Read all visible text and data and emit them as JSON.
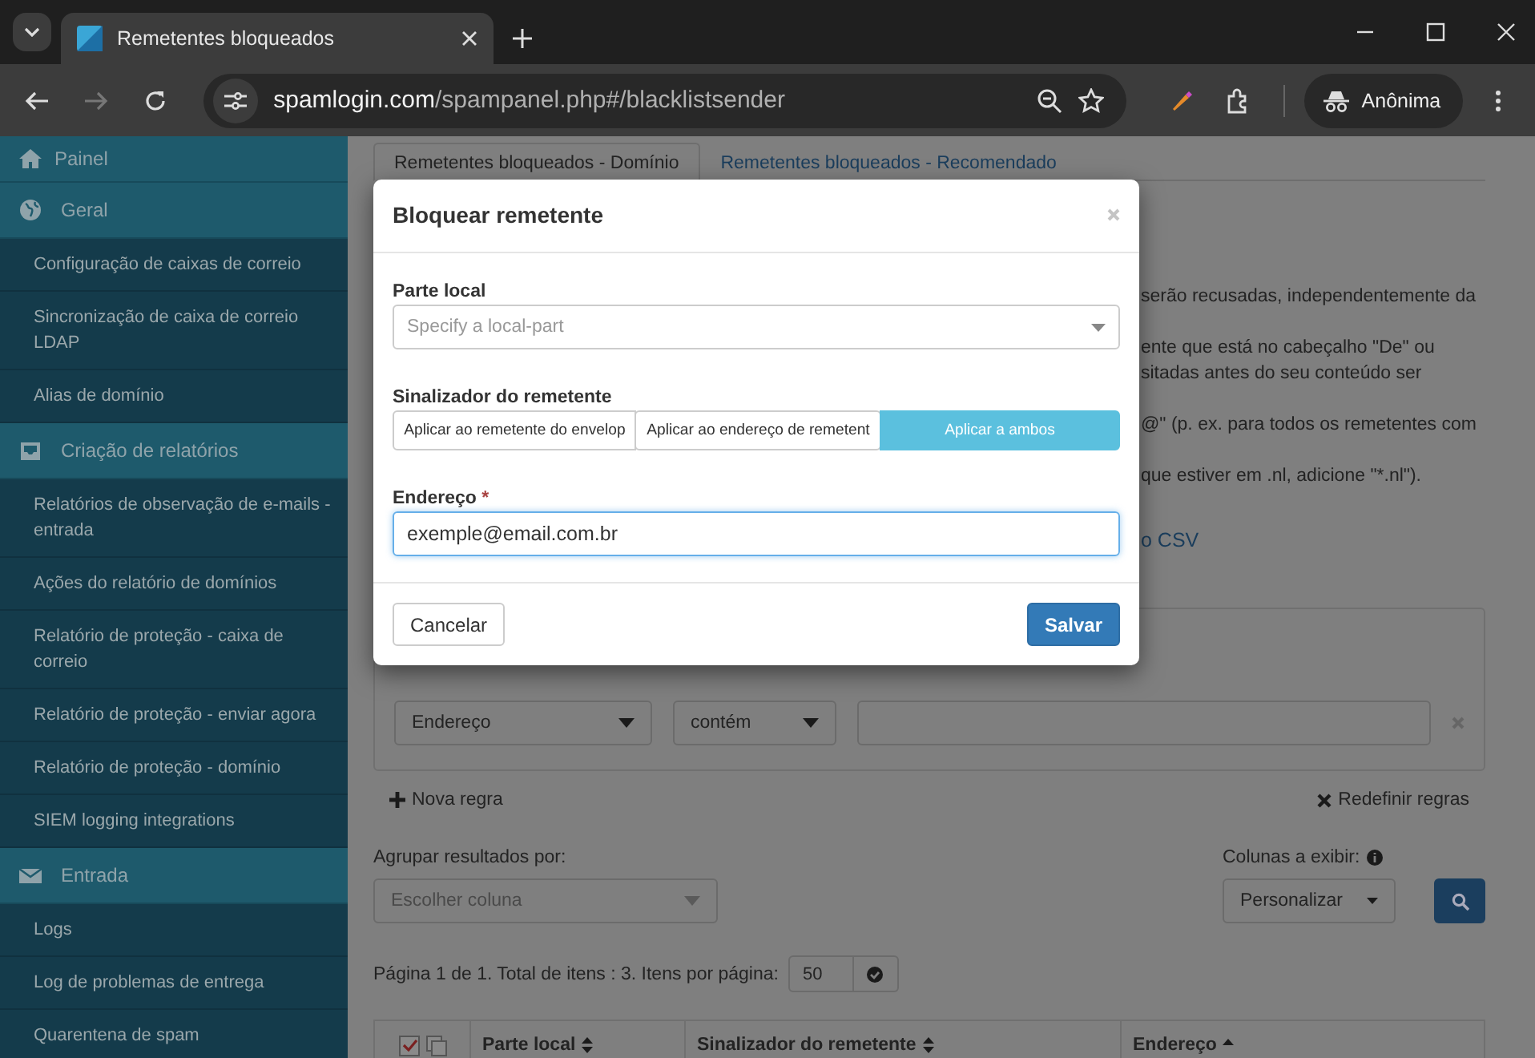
{
  "browser": {
    "tab_title": "Remetentes bloqueados",
    "url_host": "spamlogin.com",
    "url_path": "/spampanel.php#/blacklistsender",
    "profile": "Anônima"
  },
  "sidebar": {
    "items": [
      {
        "kind": "section",
        "label": "Painel"
      },
      {
        "kind": "section",
        "label": "Geral"
      },
      {
        "kind": "link",
        "label": "Configuração de caixas de correio"
      },
      {
        "kind": "link",
        "label": "Sincronização de caixa de correio LDAP"
      },
      {
        "kind": "link",
        "label": "Alias de domínio"
      },
      {
        "kind": "section",
        "label": "Criação de relatórios"
      },
      {
        "kind": "link",
        "label": "Relatórios de observação de e-mails - entrada"
      },
      {
        "kind": "link",
        "label": "Ações do relatório de domínios"
      },
      {
        "kind": "link",
        "label": "Relatório de proteção - caixa de correio"
      },
      {
        "kind": "link",
        "label": "Relatório de proteção - enviar agora"
      },
      {
        "kind": "link",
        "label": "Relatório de proteção - domínio"
      },
      {
        "kind": "link",
        "label": "SIEM logging integrations"
      },
      {
        "kind": "section",
        "label": "Entrada"
      },
      {
        "kind": "link",
        "label": "Logs"
      },
      {
        "kind": "link",
        "label": "Log de problemas de entrega"
      },
      {
        "kind": "link",
        "label": "Quarentena de spam"
      }
    ]
  },
  "page": {
    "tabs": [
      {
        "label": "Remetentes bloqueados - Domínio",
        "selected": true
      },
      {
        "label": "Remetentes bloqueados - Recomendado",
        "selected": false
      }
    ],
    "description": [
      [
        "serão recusadas, independentemente da"
      ],
      [
        "ente que está no cabeçalho \"De\" ou",
        "sitadas antes do seu conteúdo ser"
      ],
      [
        "@\" (p. ex. para todos os remetentes com"
      ],
      [
        "que estiver em .nl, adicione \"*.nl\")."
      ]
    ],
    "csv_link": "o CSV",
    "filter": {
      "field": "Endereço",
      "operator": "contém"
    },
    "add_rule": "Nova regra",
    "reset_rules": "Redefinir regras",
    "group_by": {
      "label": "Agrupar resultados por:",
      "placeholder": "Escolher coluna"
    },
    "columns": {
      "label": "Colunas a exibir:",
      "value": "Personalizar"
    },
    "pagination": {
      "text": "Página 1 de 1. Total de itens : 3. Itens por página:",
      "per_page": "50"
    },
    "table": {
      "columns": [
        {
          "label": "Parte local",
          "sorted": false
        },
        {
          "label": "Sinalizador do remetente",
          "sorted": false
        },
        {
          "label": "Endereço",
          "sorted": true
        }
      ]
    }
  },
  "modal": {
    "title": "Bloquear remetente",
    "local_part": {
      "label": "Parte local",
      "placeholder": "Specify a local-part"
    },
    "sender_flag": {
      "label": "Sinalizador do remetente",
      "options": [
        {
          "label": "Aplicar ao remetente do envelop",
          "selected": false
        },
        {
          "label": "Aplicar ao endereço de remetent",
          "selected": false
        },
        {
          "label": "Aplicar a ambos",
          "selected": true
        }
      ]
    },
    "address": {
      "label": "Endereço",
      "required_mark": "*",
      "value": "exemple@email.com.br",
      "focused": true
    },
    "cancel": "Cancelar",
    "save": "Salvar"
  }
}
